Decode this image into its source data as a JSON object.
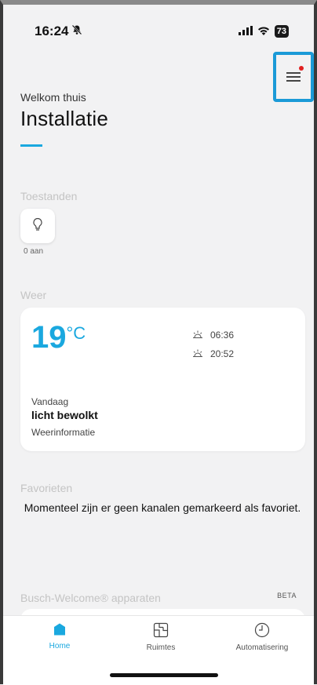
{
  "status_bar": {
    "time": "16:24",
    "battery": "73"
  },
  "header": {
    "greeting": "Welkom thuis",
    "title": "Installatie"
  },
  "menu": {
    "icon": "hamburger-menu-icon",
    "notification_color": "#e02020"
  },
  "devices": {
    "section_label": "Toestanden",
    "tile_icon": "lightbulb-icon",
    "count_label": "0 aan"
  },
  "weather": {
    "section_label": "Weer",
    "temperature": "19",
    "unit": "°C",
    "sunrise": "06:36",
    "sunset": "20:52",
    "day_label": "Vandaag",
    "condition": "licht bewolkt",
    "link_label": "Weerinformatie"
  },
  "favorites": {
    "section_label": "Favorieten",
    "empty_message": "Momenteel zijn er geen kanalen gemarkeerd als favoriet."
  },
  "busch_welcome": {
    "section_label": "Busch-Welcome® apparaten",
    "badge": "BETA"
  },
  "tabs": [
    {
      "label": "Home",
      "icon": "home-icon",
      "active": true
    },
    {
      "label": "Ruimtes",
      "icon": "rooms-icon",
      "active": false
    },
    {
      "label": "Automatisering",
      "icon": "clock-icon",
      "active": false
    }
  ],
  "colors": {
    "accent": "#1aa8df",
    "highlight_border": "#1b9ad7",
    "background": "#f2f2f3"
  }
}
